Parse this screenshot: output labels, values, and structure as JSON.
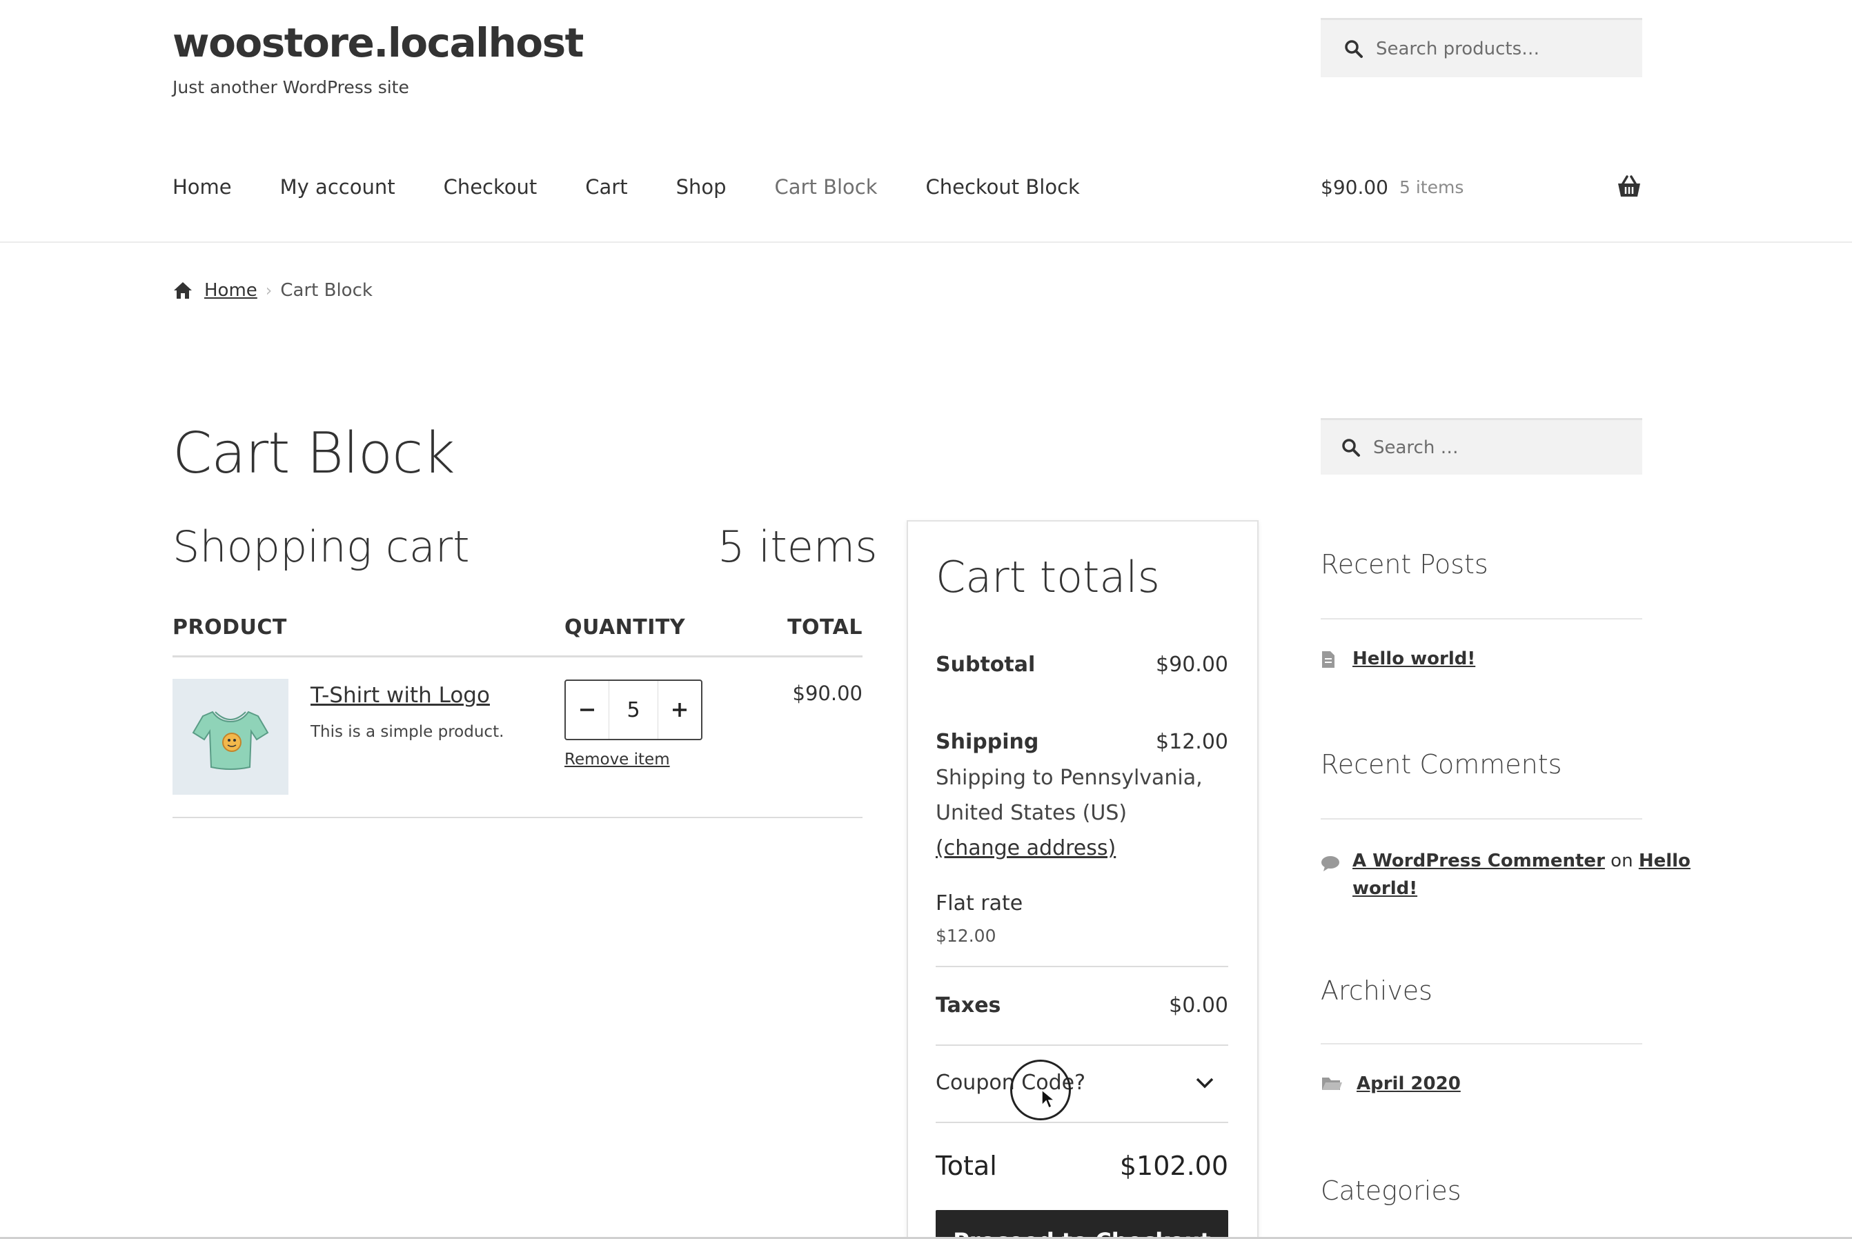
{
  "site": {
    "title": "woostore.localhost",
    "description": "Just another WordPress site"
  },
  "header_search": {
    "placeholder": "Search products…"
  },
  "nav": {
    "items": [
      "Home",
      "My account",
      "Checkout",
      "Cart",
      "Shop",
      "Cart Block",
      "Checkout Block"
    ],
    "current": "Cart Block"
  },
  "mini_cart": {
    "amount": "$90.00",
    "count": "5 items"
  },
  "breadcrumb": {
    "home": "Home",
    "current": "Cart Block"
  },
  "page": {
    "title": "Cart Block"
  },
  "cart": {
    "heading": "Shopping cart",
    "count": "5 items",
    "columns": {
      "product": "PRODUCT",
      "quantity": "QUANTITY",
      "total": "TOTAL"
    },
    "items": [
      {
        "name": "T-Shirt with Logo",
        "description": "This is a simple product.",
        "quantity": "5",
        "remove_label": "Remove item",
        "total": "$90.00"
      }
    ]
  },
  "totals": {
    "title": "Cart totals",
    "subtotal_label": "Subtotal",
    "subtotal_value": "$90.00",
    "shipping_label": "Shipping",
    "shipping_value": "$12.00",
    "shipping_to_line1": "Shipping to Pennsylvania,",
    "shipping_to_line2": "United States (US)",
    "change_address": "(change address)",
    "method_name": "Flat rate",
    "method_price": "$12.00",
    "taxes_label": "Taxes",
    "taxes_value": "$0.00",
    "coupon_label": "Coupon Code?",
    "total_label": "Total",
    "total_value": "$102.00",
    "checkout_button": "Proceed to Checkout"
  },
  "sidebar": {
    "search_placeholder": "Search …",
    "recent_posts_title": "Recent Posts",
    "recent_posts": [
      "Hello world!"
    ],
    "recent_comments_title": "Recent Comments",
    "comment": {
      "author": "A WordPress Commenter",
      "on": "on",
      "post_line1": "Hello",
      "post_line2": "world!"
    },
    "archives_title": "Archives",
    "archives": [
      "April 2020"
    ],
    "categories_title": "Categories"
  },
  "colors": {
    "accent": "#333333",
    "button_bg": "#262626",
    "search_bg": "#f2f2f2",
    "product_thumb_bg": "#e4ebf0"
  },
  "icons": [
    "search-icon",
    "basket-icon",
    "home-icon",
    "minus-icon",
    "plus-icon",
    "chevron-down-icon",
    "document-icon",
    "comment-icon",
    "folder-icon"
  ]
}
